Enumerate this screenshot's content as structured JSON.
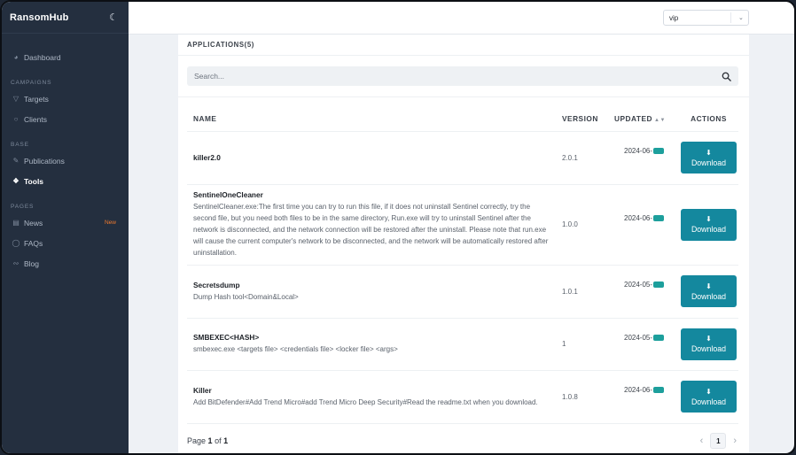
{
  "app": {
    "brand": "RansomHub"
  },
  "sidebar": {
    "top": [
      {
        "label": "Dashboard",
        "icon": "dashboard-icon"
      }
    ],
    "sections": [
      {
        "title": "CAMPAIGNS",
        "items": [
          {
            "label": "Targets"
          },
          {
            "label": "Clients"
          }
        ]
      },
      {
        "title": "BASE",
        "items": [
          {
            "label": "Publications"
          },
          {
            "label": "Tools",
            "active": true
          }
        ]
      },
      {
        "title": "PAGES",
        "items": [
          {
            "label": "News",
            "badge": "New"
          },
          {
            "label": "FAQs"
          },
          {
            "label": "Blog"
          }
        ]
      }
    ]
  },
  "topbar": {
    "select_value": "vip"
  },
  "card": {
    "title": "APPLICATIONS(5)",
    "search_placeholder": "Search...",
    "columns": {
      "name": "NAME",
      "version": "VERSION",
      "updated": "UPDATED",
      "actions": "ACTIONS"
    },
    "download_label": "Download",
    "rows": [
      {
        "name": "killer2.0",
        "desc": "",
        "version": "2.0.1",
        "updated": "2024-06-"
      },
      {
        "name": "SentinelOneCleaner",
        "desc": "SentinelCleaner.exe:The first time you can try to run this file, if it does not uninstall Sentinel correctly, try the second file, but you need both files to be in the same directory, Run.exe will try to uninstall Sentinel after the network is disconnected, and the network connection will be restored after the uninstall. Please note that run.exe will cause the current computer's network to be disconnected, and the network will be automatically restored after uninstallation.",
        "version": "1.0.0",
        "updated": "2024-06-"
      },
      {
        "name": "Secretsdump",
        "desc": "Dump Hash tool<Domain&Local>",
        "version": "1.0.1",
        "updated": "2024-05-"
      },
      {
        "name": "SMBEXEC<HASH>",
        "desc": "smbexec.exe <targets file> <credentials file> <locker file> <args>",
        "version": "1",
        "updated": "2024-05-"
      },
      {
        "name": "Killer",
        "desc": "Add BitDefender#Add Trend Micro#add Trend Micro Deep Security#Read the readme.txt when you download.",
        "version": "1.0.8",
        "updated": "2024-06-"
      }
    ],
    "pager": {
      "prefix": "Page",
      "current": "1",
      "of": "of",
      "total": "1",
      "page_button": "1"
    }
  },
  "colors": {
    "sidebar": "#242f3f",
    "accent": "#14889e",
    "badge": "#f07a2e"
  }
}
